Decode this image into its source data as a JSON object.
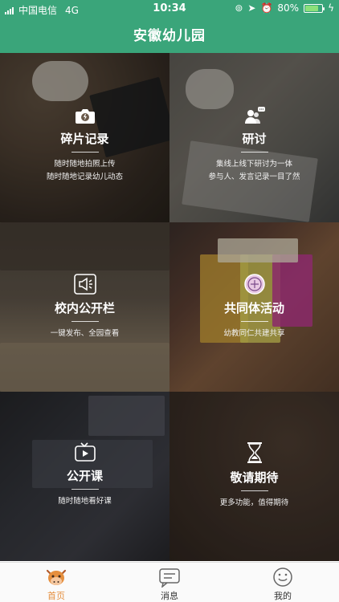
{
  "status_bar": {
    "carrier": "中国电信",
    "network": "4G",
    "time": "10:34",
    "battery": "80%",
    "battery_level": 0.8
  },
  "header": {
    "title": "安徽幼儿园"
  },
  "tiles": [
    {
      "name": "碎片记录",
      "desc": [
        "随时随地拍照上传",
        "随时随地记录幼儿动态"
      ],
      "icon": "camera-icon"
    },
    {
      "name": "研讨",
      "desc": [
        "集线上线下研讨为一体",
        "参与人、发言记录一目了然"
      ],
      "icon": "discussion-icon"
    },
    {
      "name": "校内公开栏",
      "desc": [
        "一键发布、全园查看"
      ],
      "icon": "megaphone-icon"
    },
    {
      "name": "共同体活动",
      "desc": [
        "幼教同仁共建共享"
      ],
      "icon": "community-icon"
    },
    {
      "name": "公开课",
      "desc": [
        "随时随地看好课"
      ],
      "icon": "tv-play-icon"
    },
    {
      "name": "敬请期待",
      "desc": [
        "更多功能，值得期待"
      ],
      "icon": "hourglass-icon"
    }
  ],
  "tabbar": {
    "items": [
      {
        "label": "首页",
        "icon": "home-cow-icon",
        "active": true
      },
      {
        "label": "消息",
        "icon": "message-icon",
        "active": false
      },
      {
        "label": "我的",
        "icon": "smiley-icon",
        "active": false
      }
    ],
    "active_color": "#e58f3e"
  },
  "colors": {
    "header": "#3aa57a"
  }
}
